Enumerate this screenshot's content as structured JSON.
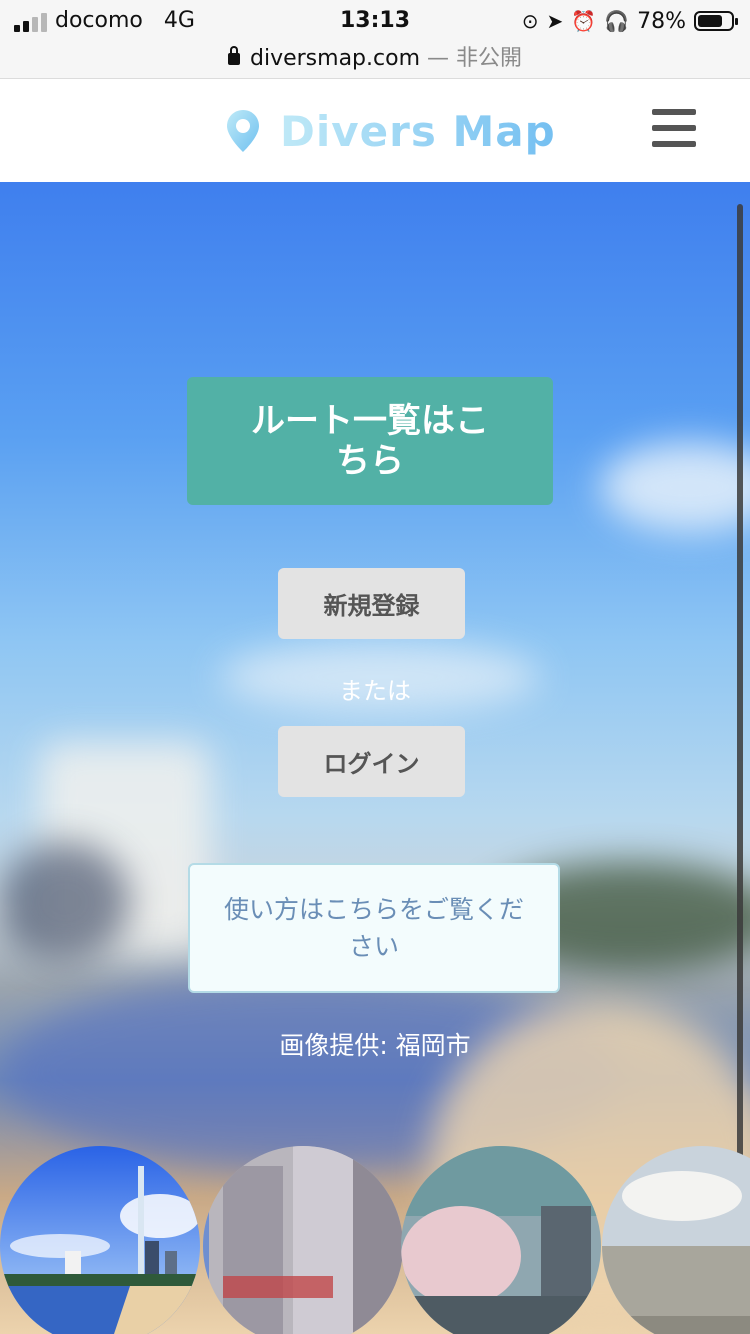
{
  "status_bar": {
    "carrier": "docomo",
    "network": "4G",
    "time": "13:13",
    "battery": "78%",
    "battery_level": 0.78,
    "url": "diversmap.com",
    "url_suffix": " — 非公開"
  },
  "header": {
    "logo_text": "Divers Map",
    "menu_icon": "hamburger-icon"
  },
  "hero": {
    "routes_button": "ルート一覧はこちら",
    "register_button": "新規登録",
    "or_text": "または",
    "login_button": "ログイン",
    "howto_button": "使い方はこちらをご覧ください",
    "image_credit": "画像提供: 福岡市"
  },
  "colors": {
    "primary_button": "#52b1a6",
    "secondary_button": "#e3e3e3",
    "howto_text": "#6a8eb6"
  }
}
